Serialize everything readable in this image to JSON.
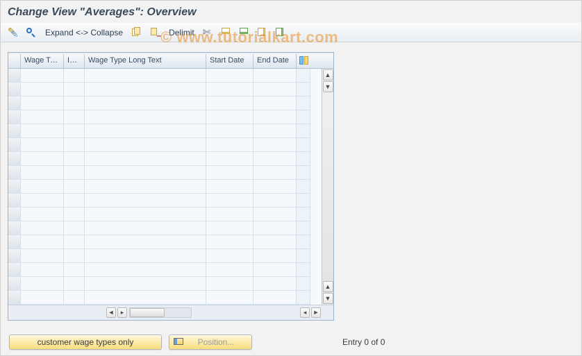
{
  "title": "Change View \"Averages\": Overview",
  "watermark": "© www.tutorialkart.com",
  "toolbar": {
    "expand_collapse_label": "Expand <-> Collapse",
    "delimit_label": "Delimit"
  },
  "grid": {
    "columns": {
      "wage_type": "Wage Ty...",
      "inf": "Inf...",
      "long_text": "Wage Type Long Text",
      "start_date": "Start Date",
      "end_date": "End Date"
    },
    "row_count": 17,
    "rows": []
  },
  "buttons": {
    "customer_filter": "customer wage types only",
    "position": "Position..."
  },
  "footer": {
    "entry_text": "Entry 0 of 0"
  }
}
